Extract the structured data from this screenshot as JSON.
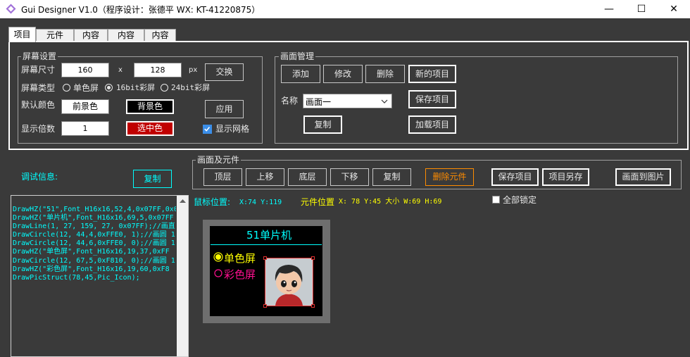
{
  "window": {
    "title": "Gui Designer V1.0（程序设计：张德平 WX: KT-41220875）",
    "minimize_glyph": "—",
    "maximize_glyph": "☐",
    "close_glyph": "✕"
  },
  "tabs": [
    "项目",
    "元件",
    "内容",
    "内容",
    "内容"
  ],
  "screen_settings": {
    "title": "屏幕设置",
    "size_label": "屏幕尺寸",
    "width": "160",
    "x_sep": "x",
    "height": "128",
    "unit": "px",
    "swap_button": "交换",
    "type_label": "屏幕类型",
    "types": [
      "单色屏",
      "16bit彩屏",
      "24bit彩屏"
    ],
    "selected_type": "16bit彩屏",
    "default_color_label": "默认颜色",
    "fg_button": "前景色",
    "bg_button": "背景色",
    "apply_button": "应用",
    "scale_label": "显示倍数",
    "scale_value": "1",
    "selected_color_button": "选中色",
    "show_grid_label": "显示网格",
    "show_grid_checked": true
  },
  "screen_mgmt": {
    "title": "画面管理",
    "add": "添加",
    "modify": "修改",
    "delete": "删除",
    "new_project": "新的项目",
    "name_label": "名称",
    "name_value": "画面一",
    "save_project": "保存项目",
    "copy": "复制",
    "load_project": "加载项目"
  },
  "debug": {
    "label": "调试信息:",
    "copy_button": "复制",
    "lines": [
      "DrawHZ(\"51\",Font_H16x16,52,4,0x07FF,0x0",
      "DrawHZ(\"单片机\",Font_H16x16,69,5,0x07FF",
      "DrawLine(1, 27, 159, 27, 0x07FF);//画直",
      "DrawCircle(12, 44,4,0xFFE0, 1);//画圆 1",
      "DrawCircle(12, 44,6,0xFFE0, 0);//画圆 1",
      "DrawHZ(\"单色屏\",Font_H16x16,19,37,0xFF",
      "DrawCircle(12, 67,5,0xF810, 0);//画圆 1",
      "DrawHZ(\"彩色屏\",Font_H16x16,19,60,0xF8",
      "DrawPicStruct(78,45,Pic_Icon);"
    ]
  },
  "canvas_group": {
    "title": "画面及元件",
    "top_layer": "顶层",
    "move_up": "上移",
    "bottom_layer": "底层",
    "move_down": "下移",
    "copy": "复制",
    "delete_element": "删除元件",
    "save_project": "保存项目",
    "save_as": "项目另存",
    "to_image": "画面到图片"
  },
  "status": {
    "mouse_label": "鼠标位置:",
    "mouse_value": "X:74 Y:119",
    "elem_label": "元件位置",
    "elem_value": "X: 78 Y:45 大小 W:69 H:69",
    "lock_all": "全部锁定",
    "lock_checked": false
  },
  "preview": {
    "title": "51单片机",
    "option1": "单色屏",
    "option2": "彩色屏"
  },
  "colors": {
    "bg": "#3a3a3a",
    "cyan": "#00ffff",
    "yellow": "#ffff00",
    "magenta": "#ff1090",
    "orange": "#ff8c00",
    "red_button": "#c00000"
  },
  "icons": [
    "app-icon",
    "minimize-icon",
    "maximize-icon",
    "close-icon",
    "dropdown-chevron-icon",
    "checkbox-check-icon",
    "scroll-up-icon"
  ]
}
